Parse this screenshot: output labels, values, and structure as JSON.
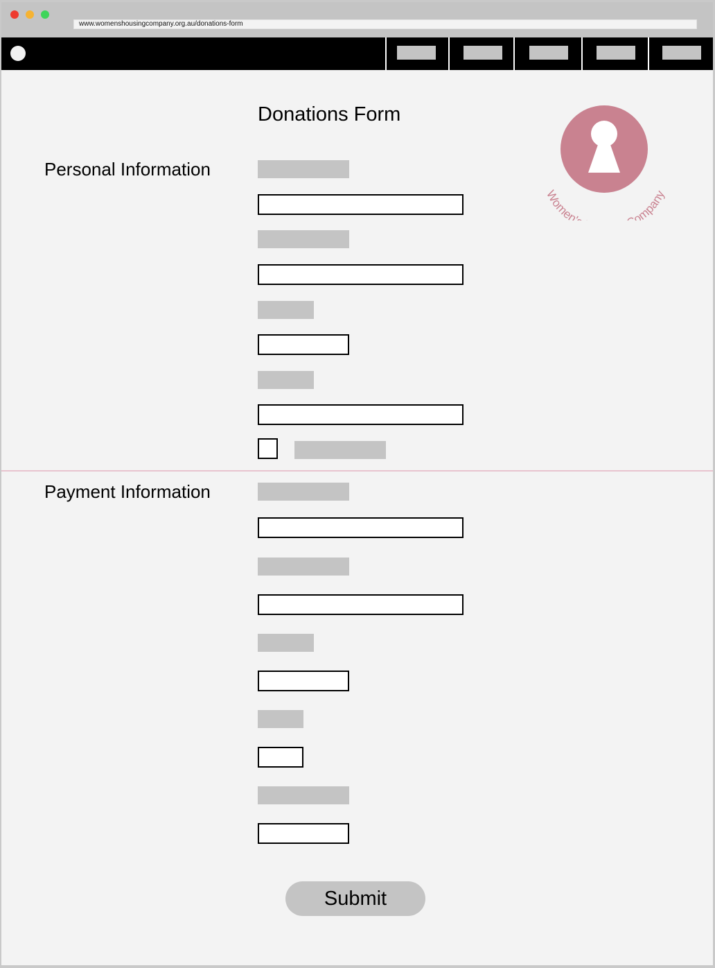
{
  "browser": {
    "url": "www.womenshousingcompany.org.au/donations-form"
  },
  "nav": {
    "items": [
      "",
      "",
      "",
      "",
      ""
    ]
  },
  "page": {
    "title": "Donations Form"
  },
  "sections": {
    "personal": {
      "heading": "Personal Information"
    },
    "payment": {
      "heading": "Payment Information"
    }
  },
  "logo": {
    "text": "Women's Housing Company",
    "color": "#c98290",
    "icon": "keyhole-icon"
  },
  "form": {
    "submit_label": "Submit"
  },
  "colors": {
    "accent": "#c98290",
    "divider": "#e8c3cf",
    "placeholder": "#c4c4c4"
  }
}
